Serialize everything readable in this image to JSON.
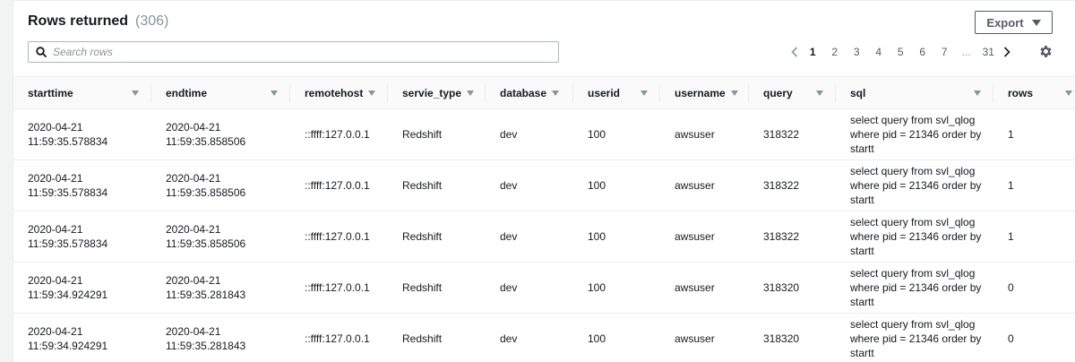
{
  "header": {
    "title": "Rows returned",
    "count": "(306)",
    "export_label": "Export"
  },
  "search": {
    "placeholder": "Search rows",
    "value": ""
  },
  "pagination": {
    "current": "1",
    "pages": [
      "1",
      "2",
      "3",
      "4",
      "5",
      "6",
      "7"
    ],
    "ellipsis": "...",
    "last": "31"
  },
  "table": {
    "columns": [
      "starttime",
      "endtime",
      "remotehost",
      "servie_type",
      "database",
      "userid",
      "username",
      "query",
      "sql",
      "rows"
    ],
    "rows": [
      {
        "starttime": "2020-04-21 11:59:35.578834",
        "endtime": "2020-04-21 11:59:35.858506",
        "remotehost": "::ffff:127.0.0.1",
        "servie_type": "Redshift",
        "database": "dev",
        "userid": "100",
        "username": "awsuser",
        "query": "318322",
        "sql": "select query from svl_qlog where pid = 21346 order by startt",
        "rows": "1"
      },
      {
        "starttime": "2020-04-21 11:59:35.578834",
        "endtime": "2020-04-21 11:59:35.858506",
        "remotehost": "::ffff:127.0.0.1",
        "servie_type": "Redshift",
        "database": "dev",
        "userid": "100",
        "username": "awsuser",
        "query": "318322",
        "sql": "select query from svl_qlog where pid = 21346 order by startt",
        "rows": "1"
      },
      {
        "starttime": "2020-04-21 11:59:35.578834",
        "endtime": "2020-04-21 11:59:35.858506",
        "remotehost": "::ffff:127.0.0.1",
        "servie_type": "Redshift",
        "database": "dev",
        "userid": "100",
        "username": "awsuser",
        "query": "318322",
        "sql": "select query from svl_qlog where pid = 21346 order by startt",
        "rows": "1"
      },
      {
        "starttime": "2020-04-21 11:59:34.924291",
        "endtime": "2020-04-21 11:59:35.281843",
        "remotehost": "::ffff:127.0.0.1",
        "servie_type": "Redshift",
        "database": "dev",
        "userid": "100",
        "username": "awsuser",
        "query": "318320",
        "sql": "select query from svl_qlog where pid = 21346 order by startt",
        "rows": "0"
      },
      {
        "starttime": "2020-04-21 11:59:34.924291",
        "endtime": "2020-04-21 11:59:35.281843",
        "remotehost": "::ffff:127.0.0.1",
        "servie_type": "Redshift",
        "database": "dev",
        "userid": "100",
        "username": "awsuser",
        "query": "318320",
        "sql": "select query from svl_qlog where pid = 21346 order by startt",
        "rows": "0"
      }
    ]
  },
  "icons": {
    "search": "search-icon",
    "export_caret": "caret-down-icon",
    "prev": "chevron-left-icon",
    "next": "chevron-right-icon",
    "settings": "gear-icon",
    "filter": "filter-triangle-icon"
  },
  "colors": {
    "text": "#16191f",
    "muted": "#879596",
    "border": "#eaeded",
    "header_bg": "#fafafa"
  }
}
